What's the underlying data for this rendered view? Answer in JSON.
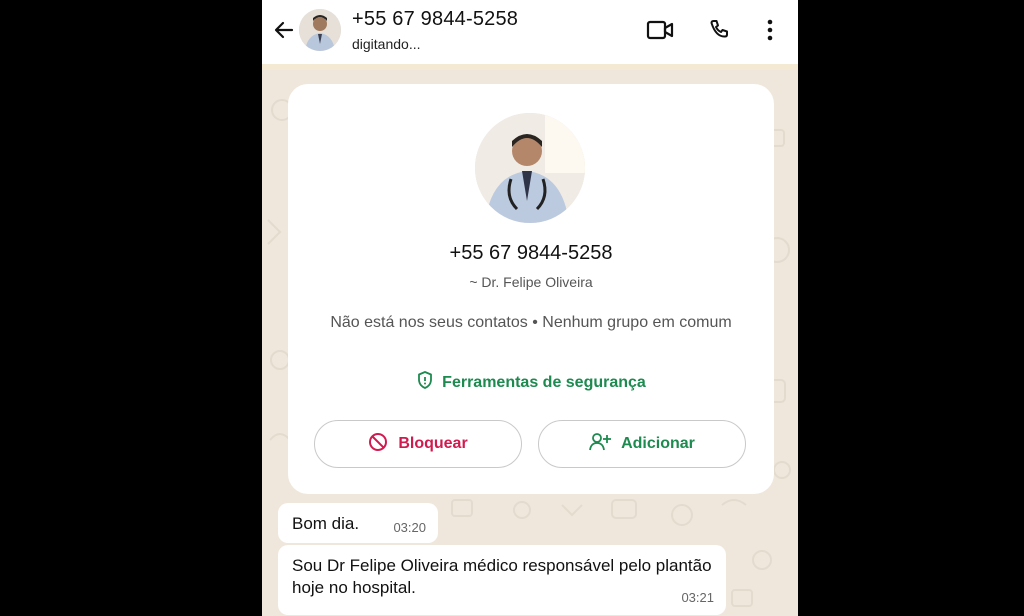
{
  "header": {
    "title": "+55 67 9844-5258",
    "status": "digitando..."
  },
  "contact_card": {
    "phone": "+55 67 9844-5258",
    "name": "~ Dr. Felipe Oliveira",
    "info": "Não está nos seus contatos • Nenhum grupo em comum",
    "security_label": "Ferramentas de segurança",
    "block_label": "Bloquear",
    "add_label": "Adicionar"
  },
  "messages": [
    {
      "text": "Bom dia.",
      "time": "03:20"
    },
    {
      "text": "Sou Dr Felipe Oliveira médico responsável pelo plantão hoje no hospital.",
      "time": "03:21"
    }
  ],
  "colors": {
    "accent_green": "#1d8a4f",
    "danger_red": "#d11a4f",
    "chat_background": "#efe7dc"
  },
  "icons": [
    "back-arrow-icon",
    "video-call-icon",
    "phone-call-icon",
    "more-options-icon",
    "shield-icon",
    "block-icon",
    "add-contact-icon"
  ]
}
